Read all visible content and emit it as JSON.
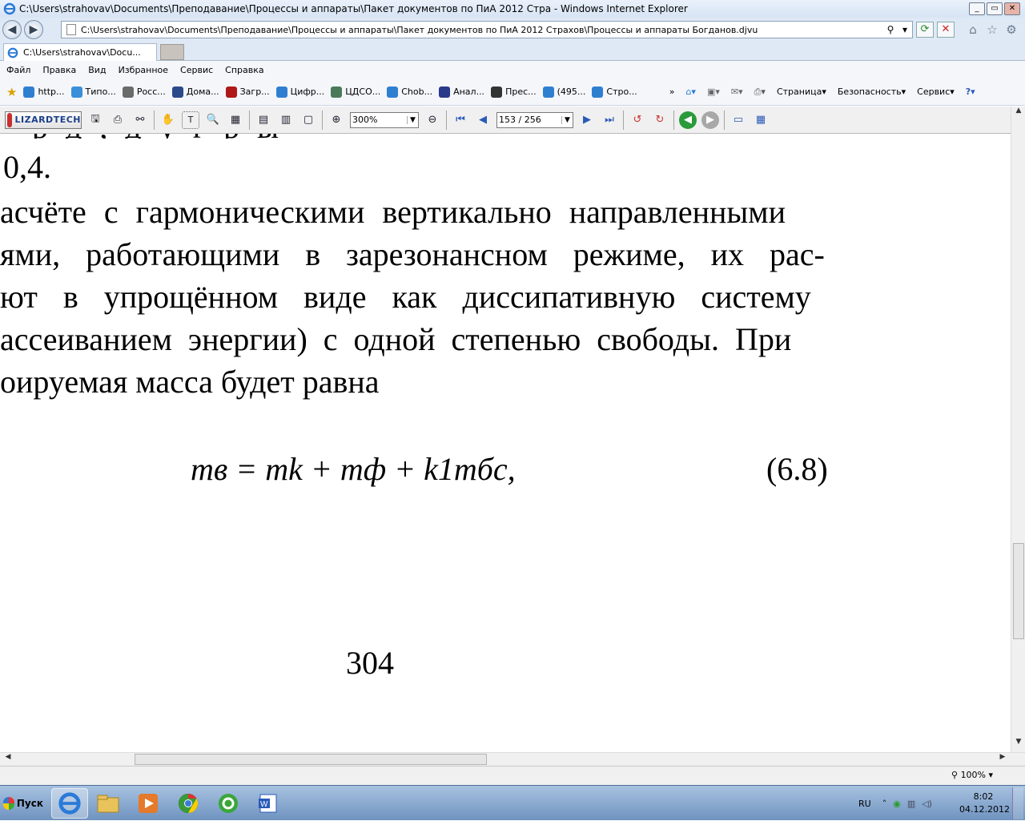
{
  "window": {
    "title": "C:\\Users\\strahovav\\Documents\\Преподавание\\Процессы и аппараты\\Пакет документов по ПиА 2012 Стра - Windows Internet Explorer",
    "min": "_",
    "max": "▭",
    "close": "✕"
  },
  "address": {
    "url": "C:\\Users\\strahovav\\Documents\\Преподавание\\Процессы и аппараты\\Пакет документов по ПиА 2012 Страхов\\Процессы и аппараты Богданов.djvu"
  },
  "tab": {
    "label": "C:\\Users\\strahovav\\Docu..."
  },
  "menu": [
    "Файл",
    "Правка",
    "Вид",
    "Избранное",
    "Сервис",
    "Справка"
  ],
  "favorites": [
    {
      "label": "http...",
      "color": "#2f7fd1"
    },
    {
      "label": "Типо...",
      "color": "#3a8fd8"
    },
    {
      "label": "Росс...",
      "color": "#6a6a6a"
    },
    {
      "label": "Дома...",
      "color": "#2a4a8a"
    },
    {
      "label": "Загр...",
      "color": "#b01818"
    },
    {
      "label": "Цифр...",
      "color": "#2f7fd1"
    },
    {
      "label": "ЦДСО...",
      "color": "#4a7a5a"
    },
    {
      "label": "Chob...",
      "color": "#2f7fd1"
    },
    {
      "label": "Анал...",
      "color": "#2a3a8a"
    },
    {
      "label": "Прес...",
      "color": "#333333"
    },
    {
      "label": "(495...",
      "color": "#2f7fd1"
    },
    {
      "label": "Стро...",
      "color": "#2f7fd1"
    }
  ],
  "commands": [
    "Страница",
    "Безопасность",
    "Сервис"
  ],
  "djvu": {
    "logo": "LIZARDTECH",
    "zoom": "300%",
    "page": "153 / 256"
  },
  "document": {
    "lines": [
      "0,4.",
      "асчёте с гармоническими вертикально направленными",
      "ями, работающими в зарезонансном режиме, их рас-",
      "ют в упрощённом виде как диссипативную систему",
      "ассеиванием энергии) с одной степенью свободы. При",
      "оируемая масса будет равна"
    ],
    "formula": "mв = mk + mф + k1mбc,",
    "equation_number": "(6.8)",
    "page_number": "304"
  },
  "status": {
    "zoom": "100%"
  },
  "taskbar": {
    "start": "Пуск",
    "lang": "RU",
    "time": "8:02",
    "date": "04.12.2012"
  }
}
